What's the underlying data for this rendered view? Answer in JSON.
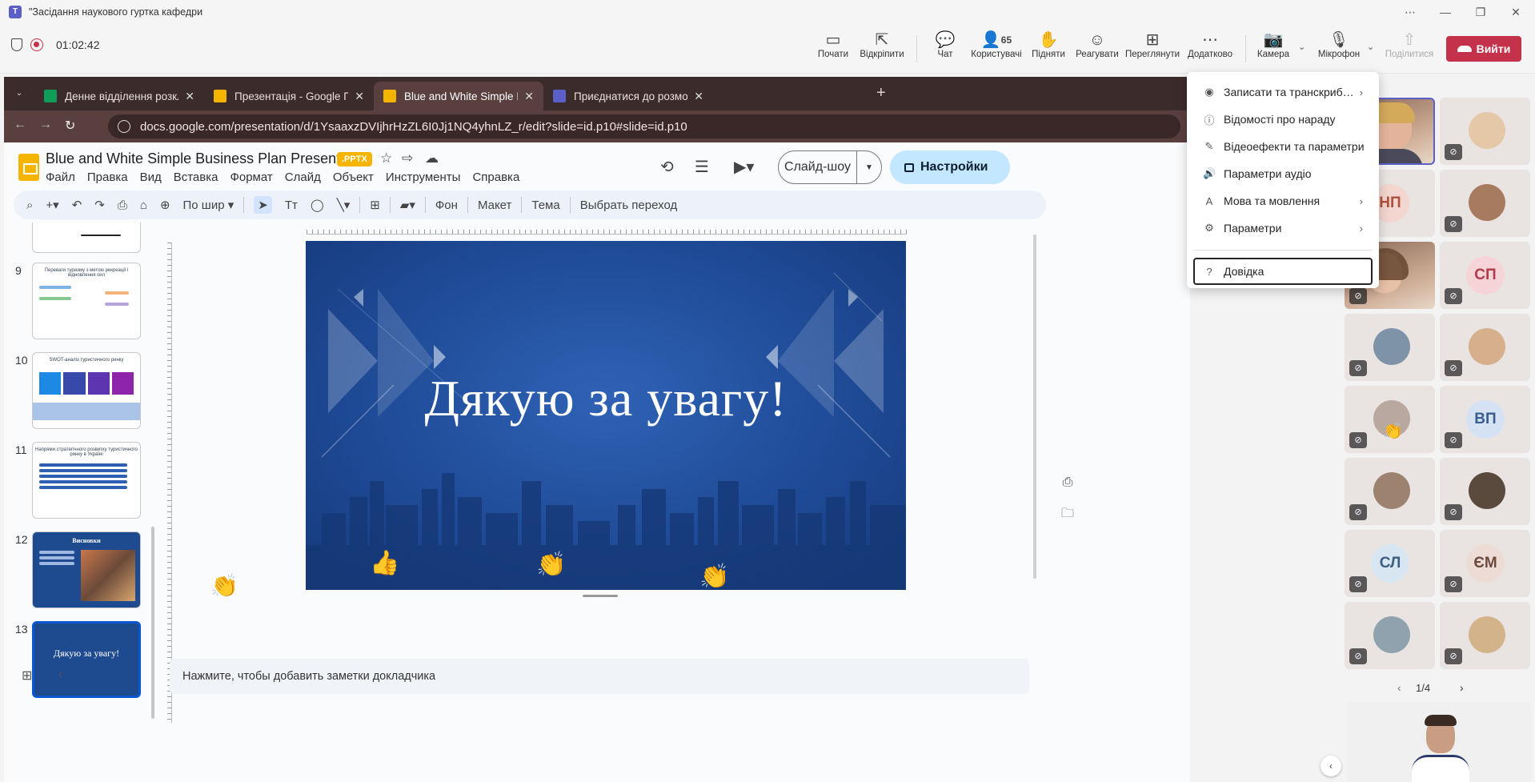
{
  "window": {
    "title": "\"Засідання наукового гуртка кафедри",
    "app_icon": "teams-icon"
  },
  "meeting": {
    "timer": "01:02:42",
    "tools": [
      {
        "key": "start",
        "label": "Почати",
        "icon": "▭"
      },
      {
        "key": "popout",
        "label": "Відкріпити",
        "icon": "⇱"
      },
      {
        "key": "chat",
        "label": "Чат",
        "icon": "💬"
      },
      {
        "key": "people",
        "label": "Користувачі",
        "icon": "👤",
        "count": "65"
      },
      {
        "key": "raise",
        "label": "Підняти",
        "icon": "✋"
      },
      {
        "key": "react",
        "label": "Реагувати",
        "icon": "☺"
      },
      {
        "key": "view",
        "label": "Переглянути",
        "icon": "⊞"
      },
      {
        "key": "more",
        "label": "Додатково",
        "icon": "⋯"
      },
      {
        "key": "camera",
        "label": "Камера",
        "icon": "📷"
      },
      {
        "key": "mic",
        "label": "Мікрофон",
        "icon": "🎙"
      },
      {
        "key": "share",
        "label": "Поділитися",
        "icon": "⇧"
      }
    ],
    "leave_label": "Вийти"
  },
  "more_menu": {
    "items": [
      {
        "label": "Записати та транскриб…",
        "icon": "◉",
        "submenu": true
      },
      {
        "label": "Відомості про нараду",
        "icon": "ⓘ",
        "submenu": false
      },
      {
        "label": "Відеоефекти та параметри",
        "icon": "✎",
        "submenu": false
      },
      {
        "label": "Параметри аудіо",
        "icon": "🔊",
        "submenu": false
      },
      {
        "label": "Мова та мовлення",
        "icon": "A",
        "submenu": true
      },
      {
        "label": "Параметри",
        "icon": "⚙",
        "submenu": true
      },
      {
        "label": "Довідка",
        "icon": "?",
        "submenu": false
      }
    ]
  },
  "browser": {
    "tabs": [
      {
        "label": "Денне відділення розклад зан",
        "favicon_color": "#0f9d58"
      },
      {
        "label": "Презентація - Google Презент",
        "favicon_color": "#f4b400"
      },
      {
        "label": "Blue and White Simple Business",
        "favicon_color": "#f4b400"
      },
      {
        "label": "Приєднатися до розмови",
        "favicon_color": "#5b5fc7"
      }
    ],
    "url": "docs.google.com/presentation/d/1YsaaxzDVIjhrHzZL6I0Jj1NQ4yhnLZ_r/edit?slide=id.p10#slide=id.p10"
  },
  "slides": {
    "doc_title": "Blue and White Simple Business Plan Presentation",
    "badge": ".PPTX",
    "menus": [
      "Файл",
      "Правка",
      "Вид",
      "Вставка",
      "Формат",
      "Слайд",
      "Объект",
      "Инструменты",
      "Справка"
    ],
    "slideshow_label": "Слайд-шоу",
    "share_label": "Настройки",
    "zoom_label": "По шир",
    "toolbar_text": {
      "background": "Фон",
      "layout": "Макет",
      "theme": "Тема",
      "transition": "Выбрать переход"
    },
    "thumbnails": [
      {
        "num": "9",
        "title": "Переваги туризму з метою рекреації і відновлення сил"
      },
      {
        "num": "10",
        "title": "SWOT-аналіз туристичного ринку"
      },
      {
        "num": "11",
        "title": "Напрями стратегічного розвитку туристичного ринку в Україні"
      },
      {
        "num": "12",
        "title": "Висновки"
      },
      {
        "num": "13",
        "title": "Дякую за увагу!"
      }
    ],
    "current_slide_text": "Дякую за увагу!",
    "notes_placeholder": "Нажмите, чтобы добавить заметки докладчика"
  },
  "gallery": {
    "tiles": [
      {
        "type": "video",
        "speaker": true
      },
      {
        "type": "photo",
        "muted": true,
        "photo_color": "#e4c8a8"
      },
      {
        "type": "initials",
        "initials": "НП",
        "bg": "#f3d6cf",
        "fg": "#b0503d",
        "muted": true
      },
      {
        "type": "photo",
        "muted": true,
        "photo_color": "#a77b60"
      },
      {
        "type": "video",
        "muted": true
      },
      {
        "type": "initials",
        "initials": "СП",
        "bg": "#f6d3d6",
        "fg": "#b03b4a",
        "muted": true
      },
      {
        "type": "photo",
        "muted": true,
        "photo_color": "#7f93a8"
      },
      {
        "type": "photo",
        "muted": true,
        "photo_color": "#d6b08c"
      },
      {
        "type": "photo",
        "muted": true,
        "photo_color": "#b9a8a0"
      },
      {
        "type": "initials",
        "initials": "ВП",
        "bg": "#d5e2f3",
        "fg": "#3a5d8f",
        "muted": true
      },
      {
        "type": "photo",
        "muted": true,
        "photo_color": "#9e8270"
      },
      {
        "type": "photo",
        "muted": true,
        "photo_color": "#5a4a3e"
      },
      {
        "type": "initials",
        "initials": "СЛ",
        "bg": "#d8e6f2",
        "fg": "#3b5e82",
        "muted": true
      },
      {
        "type": "initials",
        "initials": "ЄМ",
        "bg": "#ecdcd5",
        "fg": "#6e4a3e",
        "muted": true
      },
      {
        "type": "photo",
        "muted": true,
        "photo_color": "#8fa2ad"
      },
      {
        "type": "photo",
        "muted": true,
        "photo_color": "#d3b48a"
      }
    ],
    "pager": "1/4"
  },
  "colors": {
    "leave_red": "#c4314b",
    "teams_purple": "#5b5fc7",
    "slide_blue": "#1f4b97"
  }
}
